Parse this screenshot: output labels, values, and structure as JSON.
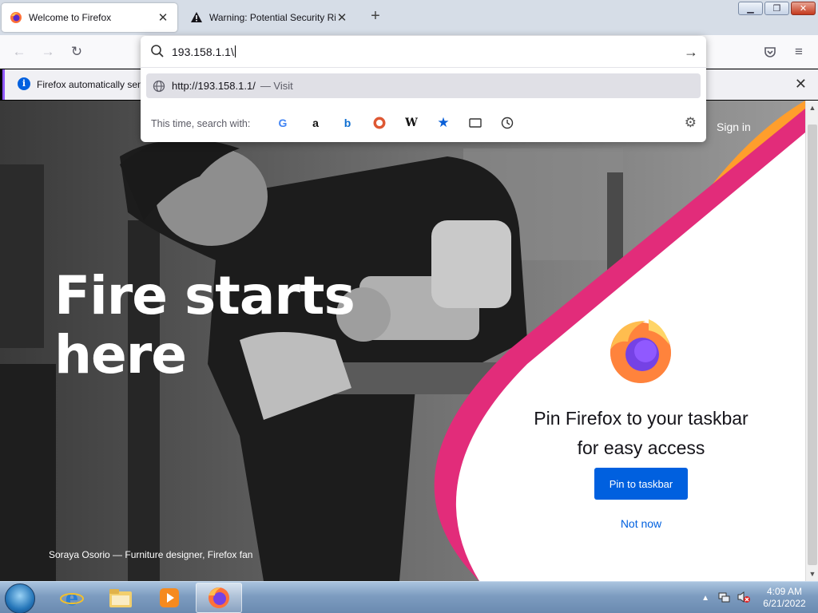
{
  "tabs": [
    {
      "title": "Welcome to Firefox",
      "icon": "firefox-icon",
      "active": true
    },
    {
      "title": "Warning: Potential Security Risk Ahead",
      "icon": "warning-icon",
      "active": false
    }
  ],
  "window_controls": {
    "minimize": "▁",
    "restore": "❐",
    "close": "✕"
  },
  "navbar": {
    "back": "back-icon",
    "forward": "forward-icon",
    "reload": "reload-icon",
    "pocket": "pocket-icon",
    "menu": "hamburger-menu-icon"
  },
  "notification": {
    "text": "Firefox automatically sen",
    "info_glyph": "i"
  },
  "url_dropdown": {
    "input_value": "193.158.1.1\\",
    "result_url": "http://193.158.1.1/",
    "result_action": "— Visit",
    "search_with_label": "This time, search with:",
    "engines": [
      "Google",
      "Amazon",
      "Bing",
      "DuckDuckGo",
      "Wikipedia",
      "Bookmarks",
      "Tabs",
      "History"
    ]
  },
  "page": {
    "hero_title_line1": "Fire starts",
    "hero_title_line2": "here",
    "caption": "Soraya Osorio — Furniture designer, Firefox fan",
    "sign_in": "Sign in",
    "pin_title_line1": "Pin Firefox to your taskbar",
    "pin_title_line2": "for easy access",
    "pin_button": "Pin to taskbar",
    "not_now": "Not now"
  },
  "colors": {
    "accent": "#0060df",
    "pink": "#e22c7a",
    "orange": "#ff9e2c",
    "notification_stripe": "#9059ff"
  },
  "taskbar": {
    "apps": [
      "internet-explorer-icon",
      "file-explorer-icon",
      "media-player-icon",
      "firefox-icon"
    ],
    "time": "4:09 AM",
    "date": "6/21/2022"
  }
}
